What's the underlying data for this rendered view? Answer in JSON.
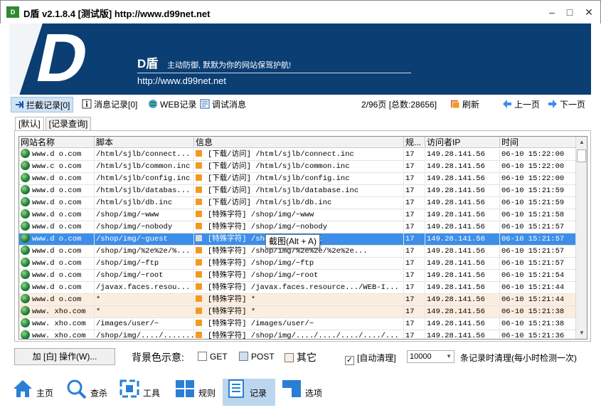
{
  "window": {
    "icon_text": "D",
    "title": "D盾 v2.1.8.4 [测试版] http://www.d99net.net",
    "buttons": [
      "minimize-icon",
      "maximize-icon",
      "close-icon"
    ]
  },
  "banner": {
    "logo_letter": "D",
    "brand": "D盾",
    "slogan": "主动防御, 默默为你的网站保驾护航!",
    "url": "http://www.d99net.net"
  },
  "toolbar": {
    "intercept_log": "拦截记录[0]",
    "message_log": "消息记录[0]",
    "web_log": "WEB记录",
    "debug_msg": "调试消息",
    "page_info": "2/96页 [总数:28656]",
    "refresh": "刷新",
    "prev_page": "上一页",
    "next_page": "下一页"
  },
  "tabs": [
    "[默认]",
    "[记录查询]"
  ],
  "table": {
    "columns": [
      "网站名称",
      "脚本",
      "信息",
      "规...",
      "访问者IP",
      "时间"
    ],
    "rows": [
      {
        "site": "www.d    o.com",
        "script": "/html/sjlb/connect...",
        "info": "[下载/访问] /html/sjlb/connect.inc",
        "rule": "17",
        "ip": "149.28.141.56",
        "time": "06-10 15:22:00",
        "style": "normal"
      },
      {
        "site": "www.c    o.com",
        "script": "/html/sjlb/common.inc",
        "info": "[下载/访问] /html/sjlb/common.inc",
        "rule": "17",
        "ip": "149.28.141.56",
        "time": "06-10 15:22:00",
        "style": "normal"
      },
      {
        "site": "www.d    o.com",
        "script": "/html/sjlb/config.inc",
        "info": "[下载/访问] /html/sjlb/config.inc",
        "rule": "17",
        "ip": "149.28.141.56",
        "time": "06-10 15:22:00",
        "style": "normal"
      },
      {
        "site": "www.d    o.com",
        "script": "/html/sjlb/databas...",
        "info": "[下载/访问] /html/sjlb/database.inc",
        "rule": "17",
        "ip": "149.28.141.56",
        "time": "06-10 15:21:59",
        "style": "normal"
      },
      {
        "site": "www.d    o.com",
        "script": "/html/sjlb/db.inc",
        "info": "[下载/访问] /html/sjlb/db.inc",
        "rule": "17",
        "ip": "149.28.141.56",
        "time": "06-10 15:21:59",
        "style": "normal"
      },
      {
        "site": "www.d    o.com",
        "script": "/shop/img/~www",
        "info": "[特殊字符] /shop/img/~www",
        "rule": "17",
        "ip": "149.28.141.56",
        "time": "06-10 15:21:58",
        "style": "normal"
      },
      {
        "site": "www.d    o.com",
        "script": "/shop/img/~nobody",
        "info": "[特殊字符] /shop/img/~nobody",
        "rule": "17",
        "ip": "149.28.141.56",
        "time": "06-10 15:21:57",
        "style": "normal"
      },
      {
        "site": "www.d    o.com",
        "script": "/shop/img/~guest",
        "info": "[特殊字符] /shop/img/~guest",
        "rule": "17",
        "ip": "149.28.141.56",
        "time": "06-10 15:21:57",
        "style": "selected"
      },
      {
        "site": "www.d    o.com",
        "script": "/shop/img/%2e%2e/%...",
        "info": "[特殊字符] /shop/img/%2e%2e/%2e%2e...",
        "rule": "17",
        "ip": "149.28.141.56",
        "time": "06-10 15:21:57",
        "style": "normal"
      },
      {
        "site": "www.d    o.com",
        "script": "/shop/img/~ftp",
        "info": "[特殊字符] /shop/img/~ftp",
        "rule": "17",
        "ip": "149.28.141.56",
        "time": "06-10 15:21:57",
        "style": "normal"
      },
      {
        "site": "www.d    o.com",
        "script": "/shop/img/~root",
        "info": "[特殊字符] /shop/img/~root",
        "rule": "17",
        "ip": "149.28.141.56",
        "time": "06-10 15:21:54",
        "style": "normal"
      },
      {
        "site": "www.d    o.com",
        "script": "/javax.faces.resou...",
        "info": "[特殊字符] /javax.faces.resource.../WEB-I...",
        "rule": "17",
        "ip": "149.28.141.56",
        "time": "06-10 15:21:44",
        "style": "normal"
      },
      {
        "site": "www.d    o.com",
        "script": "*",
        "info": "[特殊字符] *",
        "rule": "17",
        "ip": "149.28.141.56",
        "time": "06-10 15:21:44",
        "style": "highlight"
      },
      {
        "site": "www.   xho.com",
        "script": "*",
        "info": "[特殊字符] *",
        "rule": "17",
        "ip": "149.28.141.56",
        "time": "06-10 15:21:38",
        "style": "highlight"
      },
      {
        "site": "www.   xho.com",
        "script": "/images/user/~",
        "info": "[特殊字符] /images/user/~",
        "rule": "17",
        "ip": "149.28.141.56",
        "time": "06-10 15:21:38",
        "style": "normal"
      },
      {
        "site": "www.   xho.com",
        "script": "/shop/img/..../.......",
        "info": "[特殊字符] /shop/img/..../..../..../..../...",
        "rule": "17",
        "ip": "149.28.141.56",
        "time": "06-10 15:21:36",
        "style": "normal"
      }
    ]
  },
  "tooltip": "截图(Alt + A)",
  "bottom": {
    "action_button": "加 [白] 操作(W)...",
    "legend_label": "背景色示意:",
    "legend_items": [
      {
        "label": "GET",
        "color": "#ffffff"
      },
      {
        "label": "POST",
        "color": "#cfe0f3"
      },
      {
        "label": "其它",
        "color": "#fbeee0"
      }
    ],
    "auto_clean_checked": "✓",
    "auto_clean_label": "[自动清理]",
    "threshold_value": "10000",
    "clean_desc": "条记录时清理(每小时检测一次)"
  },
  "nav": [
    {
      "label": "主页",
      "icon": "home-icon"
    },
    {
      "label": "查杀",
      "icon": "magnifier-icon"
    },
    {
      "label": "工具",
      "icon": "tools-icon"
    },
    {
      "label": "规则",
      "icon": "grid-icon"
    },
    {
      "label": "记录",
      "icon": "log-icon",
      "selected": true
    },
    {
      "label": "选项",
      "icon": "options-icon"
    }
  ]
}
